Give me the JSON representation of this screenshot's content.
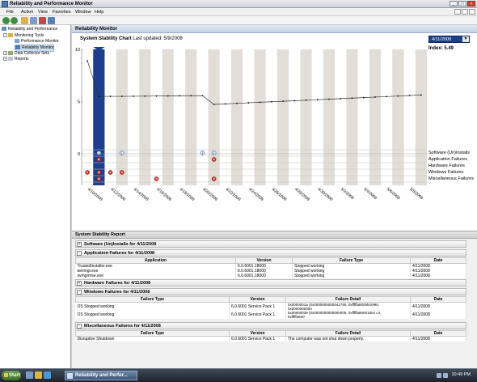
{
  "window": {
    "title": "Reliability and Performance Monitor"
  },
  "menu": [
    "File",
    "Action",
    "View",
    "Favorites",
    "Window",
    "Help"
  ],
  "tree": {
    "root": "Reliability and Performance",
    "monitoring_tools": "Monitoring Tools",
    "perf_monitor": "Performance Monitor",
    "rel_monitor": "Reliability Monitor",
    "data_collector": "Data Collector Sets",
    "reports": "Reports"
  },
  "panel_title": "Reliability Monitor",
  "chart_header": {
    "label": "System Stability Chart",
    "updated": "Last updated: 5/9/2008"
  },
  "date_select": "4/11/2008",
  "index_text": "Index: 5.49",
  "row_labels": [
    "Software (Un)Installs",
    "Application Failures",
    "Hardware Failures",
    "Windows Failures",
    "Miscellaneous Failures"
  ],
  "chart_data": {
    "type": "line",
    "x": [
      "4/10/2008",
      "4/11/2008",
      "4/12/2008",
      "4/13/2008",
      "4/14/2008",
      "4/15/2008",
      "4/16/2008",
      "4/17/2008",
      "4/18/2008",
      "4/19/2008",
      "4/20/2008",
      "4/21/2008",
      "4/22/2008",
      "4/23/2008",
      "4/24/2008",
      "4/25/2008",
      "4/26/2008",
      "4/27/2008",
      "4/28/2008",
      "4/29/2008",
      "4/30/2008",
      "5/1/2008",
      "5/2/2008",
      "5/3/2008",
      "5/4/2008",
      "5/5/2008",
      "5/6/2008",
      "5/7/2008",
      "5/8/2008",
      "5/9/2008"
    ],
    "x_tick_labels": [
      "4/10/2008",
      "4/12/2008",
      "4/14/2008",
      "4/16/2008",
      "4/18/2008",
      "4/20/2008",
      "4/22/2008",
      "4/24/2008",
      "4/26/2008",
      "4/28/2008",
      "4/30/2008",
      "5/2/2008",
      "5/4/2008",
      "5/6/2008",
      "5/8/2008"
    ],
    "y": [
      8.9,
      5.49,
      5.5,
      5.5,
      5.51,
      5.52,
      5.53,
      5.54,
      5.55,
      5.56,
      5.56,
      4.73,
      4.78,
      4.83,
      4.88,
      4.93,
      4.98,
      5.03,
      5.08,
      5.13,
      5.18,
      5.23,
      5.28,
      5.33,
      5.38,
      5.43,
      5.48,
      5.53,
      5.58,
      5.63
    ],
    "ylim": [
      0,
      10
    ],
    "y_ticks": [
      0,
      5,
      10
    ],
    "selected_index": 1,
    "grid": true
  },
  "events": {
    "software": [
      1,
      3,
      10,
      11
    ],
    "application": [
      1,
      11
    ],
    "hardware": [],
    "windows": [
      0,
      1,
      2,
      3
    ],
    "misc": [
      1,
      6,
      11
    ]
  },
  "report": {
    "title": "System Stability Report",
    "sections": {
      "software": "Software (Un)Installs for 4/11/2008",
      "application": "Application Failures for 4/11/2008",
      "hardware": "Hardware Failures for 4/11/2008",
      "windows": "Windows Failures for 4/11/2008",
      "misc": "Miscellaneous Failures for 4/11/2008"
    },
    "app_table": {
      "headers": [
        "Application",
        "Version",
        "Failure Type",
        "Date"
      ],
      "rows": [
        [
          "TrustedInstaller.exe",
          "6.0.6001.18000",
          "Stopped working",
          "4/11/2008"
        ],
        [
          "wermgr.exe",
          "6.0.6001.18000",
          "Stopped working",
          "4/11/2008"
        ],
        [
          "svmgmrse.exe",
          "6.0.6001.18000",
          "Stopped working",
          "4/11/2008"
        ]
      ]
    },
    "win_table": {
      "headers": [
        "Failure Type",
        "Version",
        "Failure Detail",
        "Date"
      ],
      "rows": [
        [
          "OS Stopped working",
          "6.0.6001 Service Pack 1",
          "0x0000001a (0x0000000000041790, 0xfffffa8005fe2990,",
          "0x0000000000",
          "4/11/2008"
        ],
        [
          "OS Stopped working",
          "6.0.6001 Service Pack 1",
          "0x00000039 (0x0000000000000005, 0xfffffa80001804 c4,",
          "0xfffffa600",
          "4/11/2008"
        ]
      ]
    },
    "misc_table": {
      "headers": [
        "Failure Type",
        "Version",
        "Failure Detail",
        "Date"
      ],
      "rows": [
        [
          "Disruptive Shutdown",
          "6.0.6001 Service Pack 1",
          "The computer was not shut down properly.",
          "4/11/2008"
        ]
      ]
    }
  },
  "taskbar": {
    "start": "Start",
    "task": "Reliability and Perfor...",
    "clock": "10:49 PM"
  }
}
